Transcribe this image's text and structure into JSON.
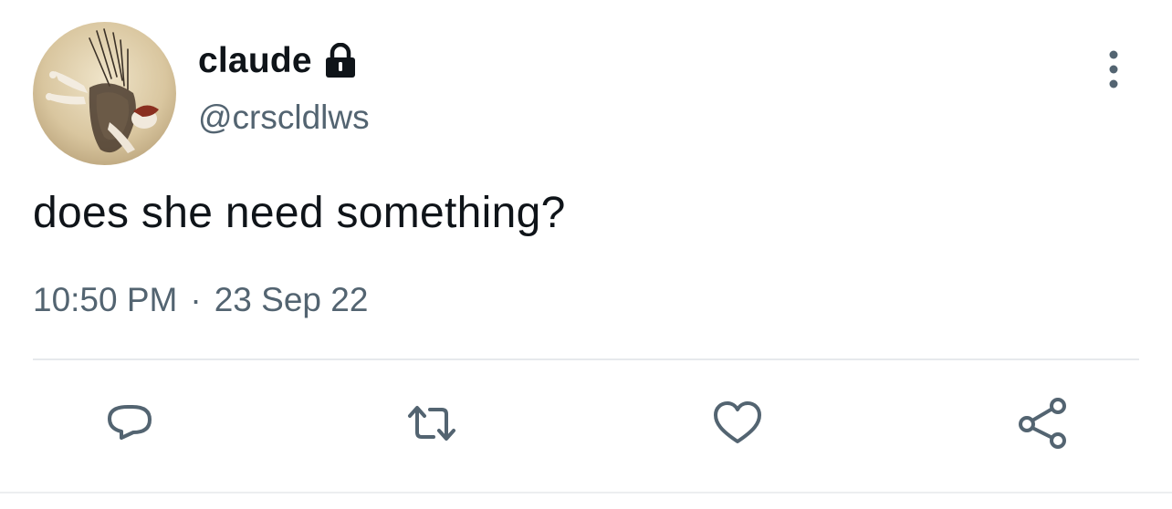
{
  "tweet": {
    "display_name": "claude",
    "handle": "@crscldlws",
    "text": "does she need something?",
    "time": "10:50 PM",
    "separator": "·",
    "date": "23 Sep 22"
  },
  "icons": {
    "account": "lock-icon",
    "menu": "more-icon",
    "actions": [
      "reply-icon",
      "retweet-icon",
      "like-icon",
      "share-icon"
    ]
  },
  "colors": {
    "text": "#0f1419",
    "secondary": "#536471",
    "icon": "#536471",
    "divider": "#e6e9ec"
  }
}
